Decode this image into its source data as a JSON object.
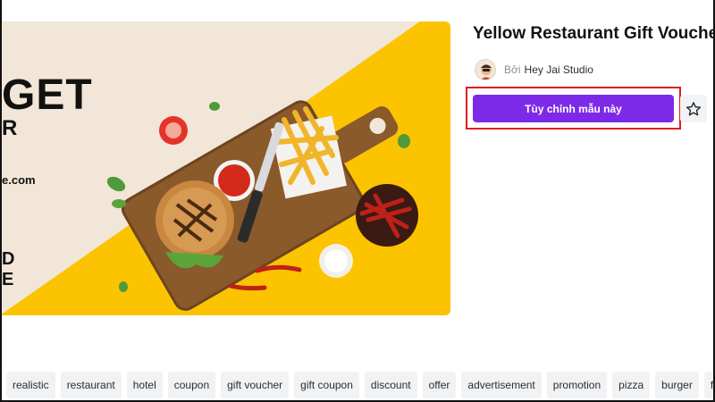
{
  "preview": {
    "headline": "GET",
    "subline": "R",
    "url_fragment": "e.com",
    "side_glyph_1": "D",
    "side_glyph_2": "E",
    "colors": {
      "background": "#f2e6d8",
      "yellow": "#fcc300",
      "board": "#8a5a2b",
      "bun": "#c9873f",
      "sauce": "#d32a1c",
      "chili": "#a81a12"
    }
  },
  "template": {
    "title": "Yellow Restaurant Gift Voucher",
    "by_label": "Bởi",
    "author_name": "Hey Jai Studio",
    "avatar_icon": "author-avatar",
    "cta_label": "Tùy chỉnh mẫu này",
    "favorite_icon": "star-icon",
    "colors": {
      "cta": "#7d2ae8",
      "highlight": "#e11a22"
    }
  },
  "tags": [
    "realistic",
    "restaurant",
    "hotel",
    "coupon",
    "gift voucher",
    "gift coupon",
    "discount",
    "offer",
    "advertisement",
    "promotion",
    "pizza",
    "burger",
    "french"
  ]
}
